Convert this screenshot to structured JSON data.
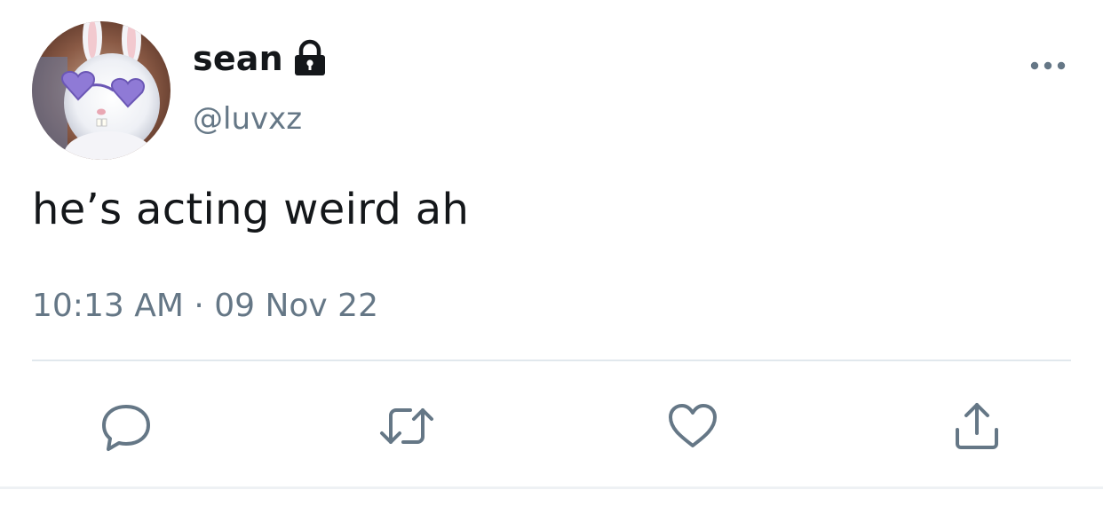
{
  "tweet": {
    "display_name": "sean",
    "handle": "@luvxz",
    "text": "he’s acting weird ah",
    "timestamp": "10:13 AM · 09 Nov 22"
  },
  "icons": {
    "account": "lock-icon",
    "menu": "more-icon",
    "reply": "reply-icon",
    "retweet": "retweet-icon",
    "like": "heart-icon",
    "share": "share-icon"
  },
  "colors": {
    "primary_text": "#14171a",
    "secondary_text": "#657786",
    "divider": "#e1e8ed"
  }
}
